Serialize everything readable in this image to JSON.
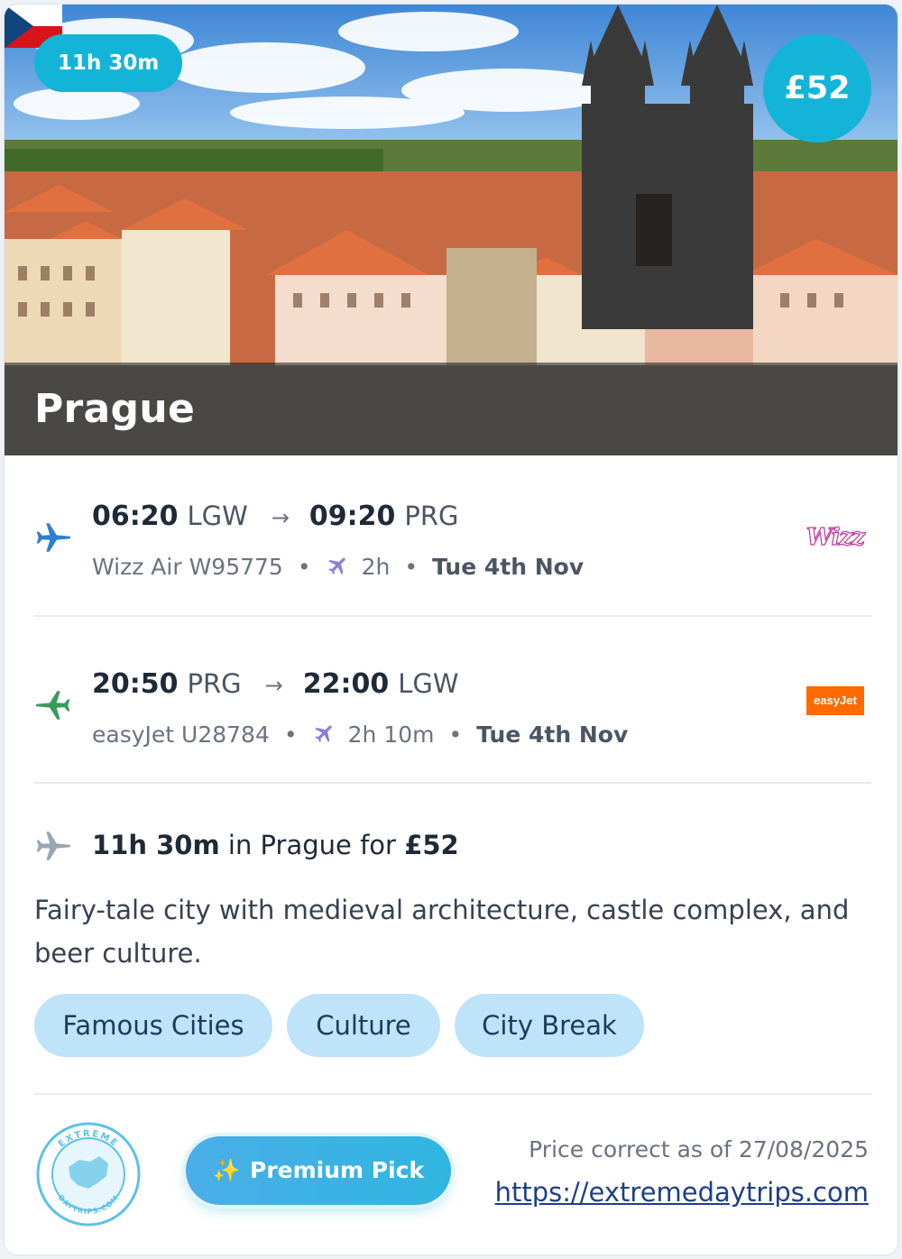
{
  "hero": {
    "city": "Prague",
    "flag_icon": "czech-flag-icon",
    "duration_badge": "11h 30m",
    "price_badge": "£52"
  },
  "outbound": {
    "depart_time": "06:20",
    "depart_code": "LGW",
    "arrow": "→",
    "arrive_time": "09:20",
    "arrive_code": "PRG",
    "flight": "Wizz Air W95775",
    "duration": "2h",
    "date": "Tue 4th Nov",
    "airline_logo_text": "Wizz",
    "plane_color": "#2f7fd0"
  },
  "return": {
    "depart_time": "20:50",
    "depart_code": "PRG",
    "arrow": "→",
    "arrive_time": "22:00",
    "arrive_code": "LGW",
    "flight": "easyJet U28784",
    "duration": "2h 10m",
    "date": "Tue 4th Nov",
    "airline_logo_text": "easyJet",
    "plane_color": "#3a9a5b"
  },
  "separator": "•",
  "summary": {
    "duration": "11h 30m",
    "middle": " in Prague for ",
    "price": "£52"
  },
  "description": "Fairy-tale city with medieval architecture, castle complex, and beer culture.",
  "tags": [
    "Famous Cities",
    "Culture",
    "City Break"
  ],
  "footer": {
    "premium_sparkle": "✨",
    "premium_label": "Premium Pick",
    "price_note": "Price correct as of 27/08/2025",
    "link": "https://extremedaytrips.com",
    "logo_text_top": "EXTREME",
    "logo_text_bottom": "DAYTRIPS.COM"
  },
  "colors": {
    "accent": "#14b4d8",
    "tag_bg": "#bfe3f8",
    "link": "#1f3f86",
    "easyjet": "#ff6a00",
    "wizz": "#c0359a"
  }
}
